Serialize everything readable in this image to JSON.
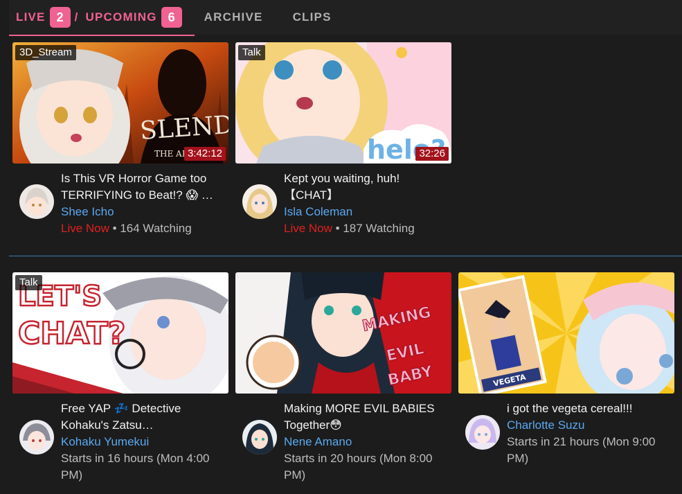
{
  "tabs": {
    "live_label": "LIVE",
    "live_count": "2",
    "separator": "/",
    "upcoming_label": "UPCOMING",
    "upcoming_count": "6",
    "archive_label": "ARCHIVE",
    "clips_label": "CLIPS"
  },
  "colors": {
    "accent": "#f06292",
    "link": "#5aa9f0",
    "live": "#e02020",
    "divider": "#3b7fb5"
  },
  "live": [
    {
      "topic": "3D_Stream",
      "duration": "3:42:12",
      "title_line1": "Is This VR Horror Game too",
      "title_line2": "TERRIFYING to Beat!? 😱 …",
      "channel": "Shee Icho",
      "live_text": "Live Now",
      "watching": "• 164 Watching"
    },
    {
      "topic": "Talk",
      "duration": "32:26",
      "title_line1": "Kept you waiting, huh!",
      "title_line2": "【CHAT】",
      "channel": "Isla Coleman",
      "live_text": "Live Now",
      "watching": "• 187 Watching"
    }
  ],
  "upcoming": [
    {
      "topic": "Talk",
      "title_line1": "Free YAP 💤 Detective",
      "title_line2": "Kohaku's Zatsu…",
      "channel": "Kohaku Yumekui",
      "status_line1": "Starts in 16 hours (Mon 4:00",
      "status_line2": "PM)"
    },
    {
      "title_line1": "Making MORE EVIL BABIES",
      "title_line2": "Together😳",
      "channel": "Nene Amano",
      "status_line1": "Starts in 20 hours (Mon 8:00",
      "status_line2": "PM)"
    },
    {
      "title_line1": "i got the vegeta cereal!!!",
      "channel": "Charlotte Suzu",
      "status_line1": "Starts in 21 hours (Mon 9:00",
      "status_line2": "PM)"
    }
  ],
  "thumb_text": {
    "slender_big": "SLENDER",
    "slender_small": "THE ARR",
    "hello_sign": "helo?",
    "lets": "LET'S",
    "chat": "CHAT?",
    "making": "MAKING",
    "evil": "EVIL",
    "baby": "BABY",
    "vegeta": "VEGETA"
  }
}
